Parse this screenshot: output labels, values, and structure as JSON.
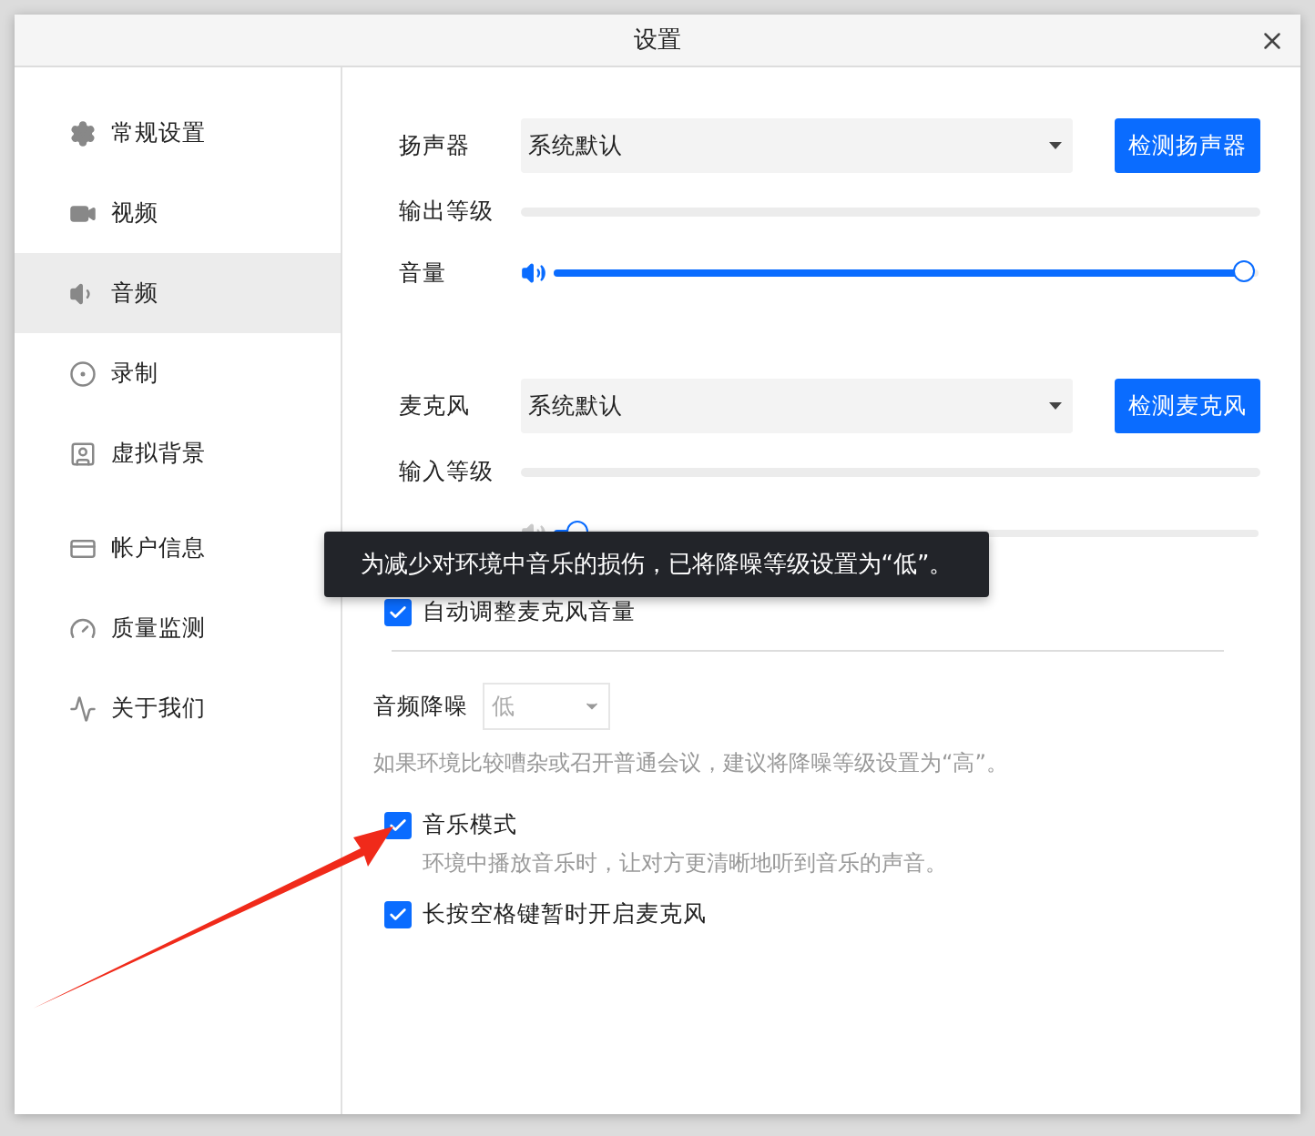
{
  "window": {
    "title": "设置"
  },
  "sidebar": {
    "groups": [
      [
        {
          "label": "常规设置",
          "selected": false
        },
        {
          "label": "视频",
          "selected": false
        },
        {
          "label": "音频",
          "selected": true
        },
        {
          "label": "录制",
          "selected": false
        },
        {
          "label": "虚拟背景",
          "selected": false
        }
      ],
      [
        {
          "label": "帐户信息",
          "selected": false
        },
        {
          "label": "质量监测",
          "selected": false
        },
        {
          "label": "关于我们",
          "selected": false
        }
      ]
    ]
  },
  "devices": [
    {
      "label": "扬声器",
      "value": "系统默认",
      "button": "检测扬声器",
      "meter_label": "输出等级",
      "meter": {
        "level": 0
      },
      "volume_label": "音量",
      "volume": {
        "level": 1
      }
    },
    {
      "label": "麦克风",
      "value": "系统默认",
      "button": "检测麦克风",
      "meter_label": "输入等级",
      "meter": {
        "level": 0
      },
      "volume": {
        "level": 0.02
      }
    }
  ],
  "auto_adjust": {
    "label": "自动调整麦克风音量",
    "checked": true
  },
  "noise": {
    "label": "音频降噪",
    "value": "低",
    "disabled": true,
    "hint": "如果环境比较嘈杂或召开普通会议，建议将降噪等级设置为“高”。"
  },
  "options": [
    {
      "label": "音乐模式",
      "checked": true,
      "hint": "环境中播放音乐时，让对方更清晰地听到音乐的声音。"
    },
    {
      "label": "长按空格键暂时开启麦克风",
      "checked": true
    }
  ],
  "toast": "为减少对环境中音乐的损伤，已将降噪等级设置为“低”。"
}
